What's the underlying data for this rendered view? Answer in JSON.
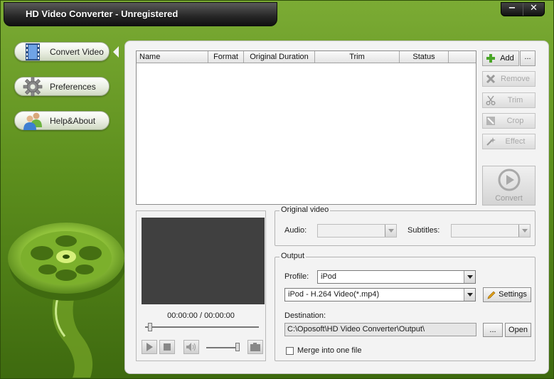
{
  "window": {
    "title": "HD Video Converter - Unregistered",
    "minimize_glyph": "−",
    "close_glyph": "✕"
  },
  "nav": {
    "items": [
      {
        "label": "Convert Video",
        "icon": "film-strip-icon",
        "active": true
      },
      {
        "label": "Preferences",
        "icon": "gear-icon",
        "active": false
      },
      {
        "label": "Help&About",
        "icon": "people-icon",
        "active": false
      }
    ]
  },
  "file_list": {
    "columns": [
      "Name",
      "Format",
      "Original Duration",
      "Trim",
      "Status"
    ],
    "rows": []
  },
  "actions": {
    "add": "Add",
    "add_more": "...",
    "remove": "Remove",
    "trim": "Trim",
    "crop": "Crop",
    "effect": "Effect",
    "convert": "Convert"
  },
  "preview": {
    "timecode": "00:00:00 / 00:00:00"
  },
  "original_video": {
    "title": "Original video",
    "audio_label": "Audio:",
    "audio_value": "",
    "subtitles_label": "Subtitles:",
    "subtitles_value": ""
  },
  "output": {
    "title": "Output",
    "profile_label": "Profile:",
    "profile_value": "iPod",
    "format_value": "iPod - H.264 Video(*.mp4)",
    "settings_label": "Settings",
    "destination_label": "Destination:",
    "destination_value": "C:\\Oposoft\\HD Video Converter\\Output\\",
    "browse_label": "...",
    "open_label": "Open",
    "merge_label": "Merge into one file",
    "merge_checked": false
  },
  "colors": {
    "background_green": "#5d8f1d",
    "panel": "#f3f3f3",
    "titlebar": "#262626"
  }
}
